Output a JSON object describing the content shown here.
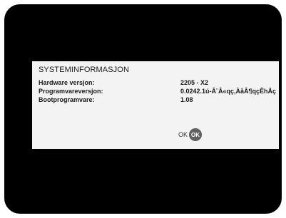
{
  "dialog": {
    "title": "SYSTEMINFORMASJON",
    "rows": [
      {
        "label": "Hardware versjon:",
        "value": "2205 - X2"
      },
      {
        "label": "Programvareversjon:",
        "value": "0.0242.1ú-Â¨Â«qç,ÀåÂ¶qçÊhÅç"
      },
      {
        "label": "Bootprogramvare:",
        "value": "1.08"
      }
    ],
    "ok_label": "OK",
    "ok_button_label": "OK"
  }
}
